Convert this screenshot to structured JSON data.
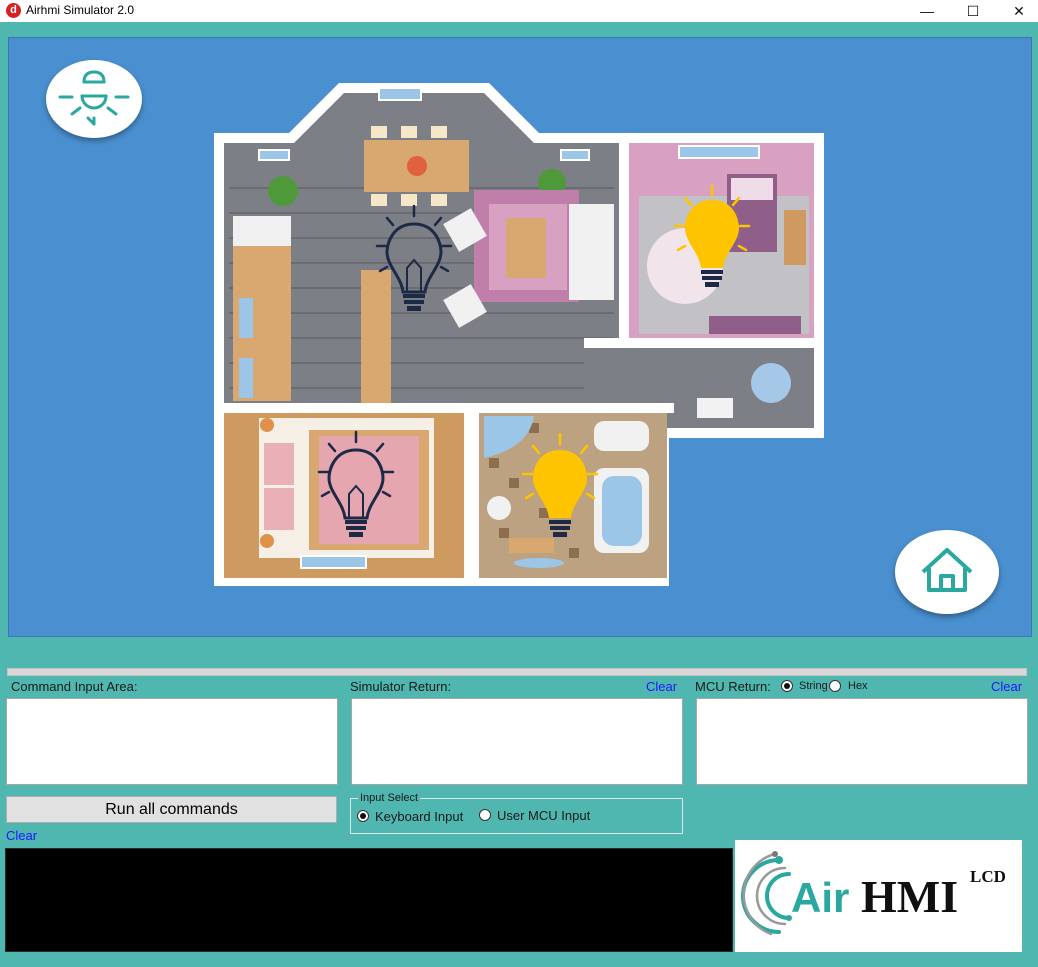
{
  "window": {
    "title": "Airhmi Simulator 2.0",
    "app_icon_glyph": "d",
    "minimize_glyph": "—",
    "maximize_glyph": "☐",
    "close_glyph": "✕"
  },
  "scene": {
    "lights": [
      {
        "room": "living-room",
        "state": "off"
      },
      {
        "room": "bedroom-right",
        "state": "on"
      },
      {
        "room": "bedroom-left",
        "state": "off"
      },
      {
        "room": "bathroom",
        "state": "on"
      }
    ],
    "colors": {
      "bulb_on": "#ffc400",
      "bulb_off": "#1d2a45",
      "background": "#4a90d0"
    }
  },
  "panel": {
    "command_label": "Command Input Area:",
    "simulator_label": "Simulator Return:",
    "simulator_clear": "Clear",
    "mcu_label": "MCU Return:",
    "mcu_string": "String",
    "mcu_hex": "Hex",
    "mcu_clear": "Clear",
    "mcu_format_selected": "String",
    "run_button": "Run all commands",
    "command_clear": "Clear",
    "input_select_title": "Input Select",
    "keyboard_input": "Keyboard Input",
    "user_mcu_input": "User MCU Input",
    "input_selected": "Keyboard Input"
  },
  "logo": {
    "brand_air": "Air",
    "brand_hmi": "HMI",
    "brand_lcd": "LCD"
  }
}
